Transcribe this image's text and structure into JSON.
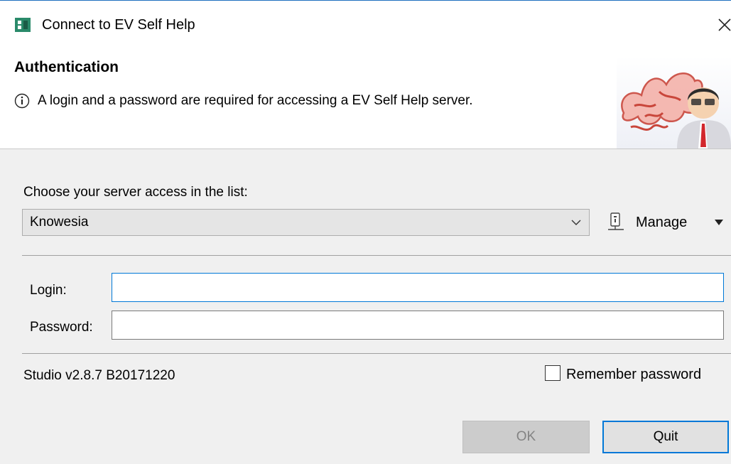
{
  "window": {
    "title": "Connect to EV Self Help"
  },
  "header": {
    "title": "Authentication",
    "info_text": "A login and a password are required for accessing a EV Self Help server."
  },
  "server": {
    "label": "Choose your server access in the list:",
    "selected": "Knowesia",
    "manage_label": "Manage"
  },
  "form": {
    "login_label": "Login:",
    "login_value": "",
    "password_label": "Password:",
    "password_value": ""
  },
  "footer": {
    "version": "Studio v2.8.7 B20171220",
    "remember_label": "Remember password",
    "remember_checked": false,
    "ok_label": "OK",
    "quit_label": "Quit"
  },
  "colors": {
    "accent": "#0078d7",
    "app_icon": "#2a8a6a",
    "body_bg": "#f0f0f0",
    "disabled_button": "#cccccc"
  },
  "icons": {
    "app": "app-icon",
    "close": "close-icon",
    "info": "info-icon",
    "dropdown": "chevron-down-icon",
    "manage": "manage-icon",
    "manage_menu": "caret-down-icon",
    "header": "header-user-logo"
  }
}
